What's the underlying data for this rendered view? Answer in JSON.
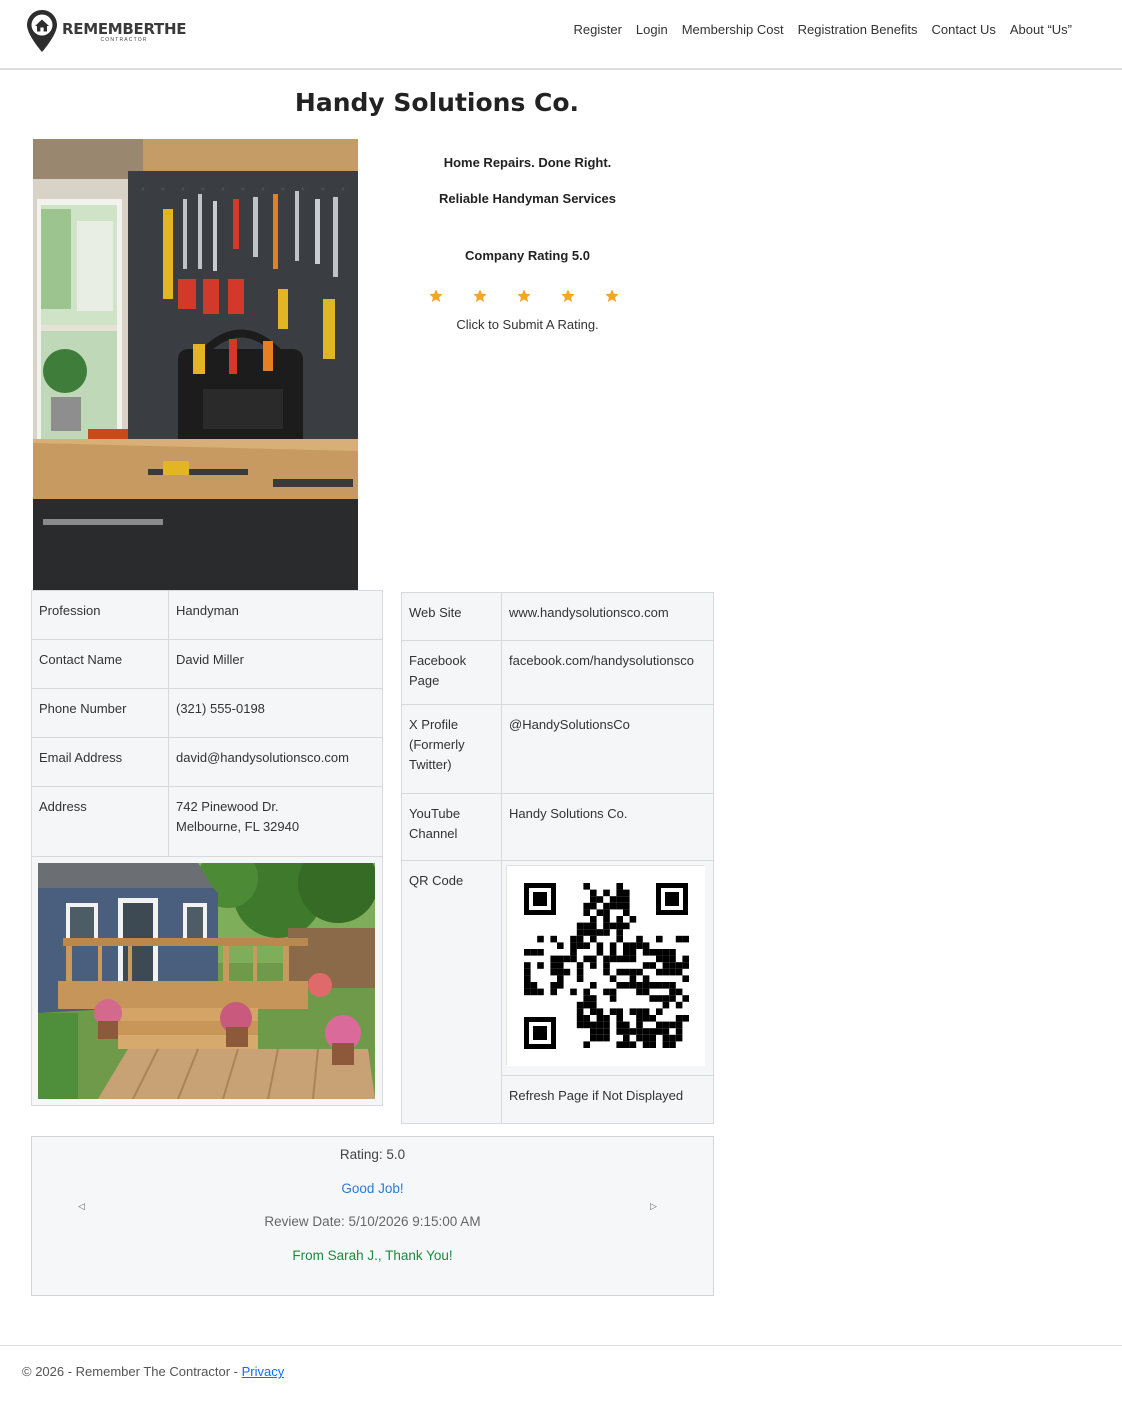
{
  "header": {
    "logo_main": "REMEMBERTHE",
    "logo_sub": "CONTRACTOR",
    "nav": [
      "Register",
      "Login",
      "Membership Cost",
      "Registration Benefits",
      "Contact Us",
      "About “Us”"
    ]
  },
  "company": {
    "name": "Handy Solutions Co.",
    "tagline1": "Home Repairs. Done Right.",
    "tagline2": "Reliable Handyman Services",
    "rating_label": "Company Rating 5.0",
    "rating_value": 5,
    "rating_hint": "Click to Submit A Rating."
  },
  "details": {
    "profession_label": "Profession",
    "profession": "Handyman",
    "contact_label": "Contact Name",
    "contact": "David Miller",
    "phone_label": "Phone Number",
    "phone": "(321) 555-0198",
    "email_label": "Email Address",
    "email": "david@handysolutionsco.com",
    "address_label": "Address",
    "address_line1": "742 Pinewood Dr.",
    "address_line2": "Melbourne, FL 32940"
  },
  "social": {
    "website_label": "Web Site",
    "website": "www.handysolutionsco.com",
    "facebook_label": "Facebook Page",
    "facebook": "facebook.com/handysolutionsco",
    "x_label": "X Profile (Formerly Twitter)",
    "x": "@HandySolutionsCo",
    "youtube_label": "YouTube Channel",
    "youtube": "Handy Solutions Co.",
    "qr_label": "QR Code",
    "qr_note": "Refresh Page if Not Displayed"
  },
  "review": {
    "rating": "Rating: 5.0",
    "title": "Good Job!",
    "date": "Review Date: 5/10/2026 9:15:00 AM",
    "author": "From Sarah J., Thank You!",
    "prev_icon": "caret-left-icon",
    "next_icon": "caret-right-icon"
  },
  "footer": {
    "copyright": "© 2026 - Remember The Contractor - ",
    "privacy": "Privacy"
  },
  "colors": {
    "star": "#f5a623",
    "link_blue": "#2a7bd4",
    "green": "#1e8a3c",
    "grey_text": "#666666"
  }
}
